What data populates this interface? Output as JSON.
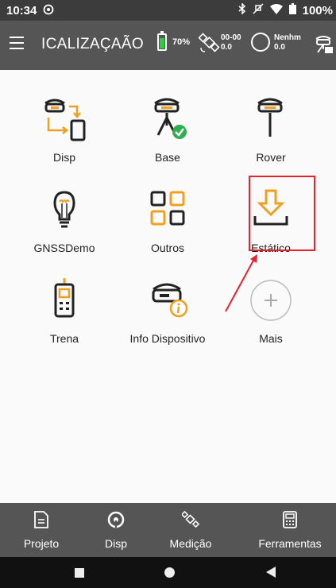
{
  "status_bar": {
    "time": "10:34",
    "battery": "100%"
  },
  "app_bar": {
    "title": "ICALIZAÇAÃO",
    "battery_level": "70%",
    "battery_fraction": 0.7,
    "sat_line1": "00-00",
    "sat_line2": "0.0",
    "fix_line1": "Nenhm",
    "fix_line2": "0.0"
  },
  "tiles": [
    {
      "label": "Disp",
      "icon": "device-connect-icon"
    },
    {
      "label": "Base",
      "icon": "base-station-icon"
    },
    {
      "label": "Rover",
      "icon": "rover-icon"
    },
    {
      "label": "GNSSDemo",
      "icon": "lightbulb-icon"
    },
    {
      "label": "Outros",
      "icon": "grid-icon"
    },
    {
      "label": "Estático",
      "icon": "download-tray-icon"
    },
    {
      "label": "Trena",
      "icon": "laser-meter-icon"
    },
    {
      "label": "Info Dispositivo",
      "icon": "device-info-icon"
    },
    {
      "label": "Mais",
      "icon": "plus-icon"
    }
  ],
  "bottom_nav": [
    {
      "label": "Projeto",
      "icon": "document-icon"
    },
    {
      "label": "Disp",
      "icon": "antenna-icon",
      "active": true
    },
    {
      "label": "Medição",
      "icon": "satellite-icon"
    },
    {
      "label": "Ferramentas",
      "icon": "calculator-icon"
    }
  ],
  "colors": {
    "bar": "#555555",
    "accent": "#f0a020",
    "highlight": "#e8212e",
    "green": "#2ecc40"
  }
}
